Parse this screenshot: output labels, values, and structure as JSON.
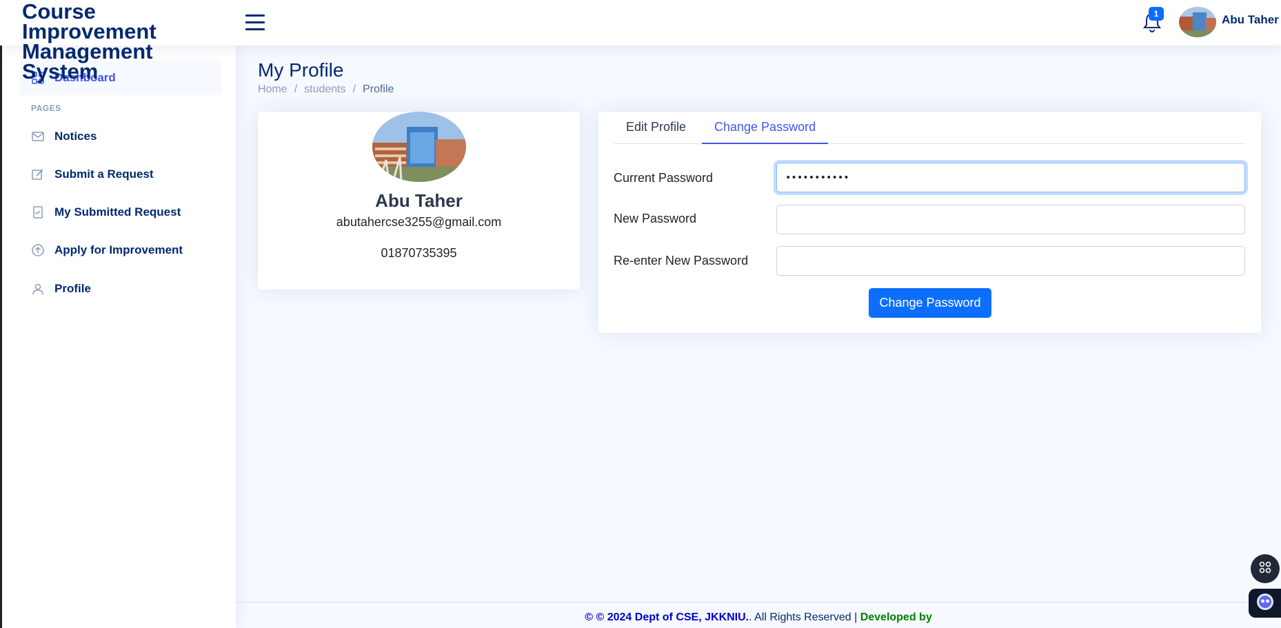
{
  "header": {
    "logo_text": "Course Improvement Management System",
    "notification_count": "1",
    "user_name": "Abu Taher"
  },
  "sidebar": {
    "heading": "PAGES",
    "items": [
      {
        "label": "Dashboard",
        "icon": "grid-icon"
      },
      {
        "label": "Notices",
        "icon": "envelope-icon"
      },
      {
        "label": "Submit a Request",
        "icon": "pencil-square-icon"
      },
      {
        "label": "My Submitted Request",
        "icon": "journal-check-icon"
      },
      {
        "label": "Apply for Improvement",
        "icon": "arrow-up-circle-icon"
      },
      {
        "label": "Profile",
        "icon": "person-icon"
      }
    ]
  },
  "main": {
    "title": "My Profile",
    "breadcrumb": [
      "Home",
      "students",
      "Profile"
    ]
  },
  "profile": {
    "name": "Abu Taher",
    "email": "abutahercse3255@gmail.com",
    "phone": "01870735395"
  },
  "tabs": [
    {
      "label": "Edit Profile",
      "active": false
    },
    {
      "label": "Change Password",
      "active": true
    }
  ],
  "form": {
    "current_password_label": "Current Password",
    "current_password_value": "•••••••••••",
    "new_password_label": "New Password",
    "new_password_value": "",
    "reenter_password_label": "Re-enter New Password",
    "reenter_password_value": "",
    "submit_label": "Change Password"
  },
  "footer": {
    "copyright": "© © 2024 Dept of CSE, JKKNIU.",
    "rights": ". All Rights Reserved | ",
    "developed": "Developed by"
  },
  "colors": {
    "primary": "#0d6efd",
    "accent": "#4154f1",
    "navy": "#012970",
    "background": "#f6f9ff"
  }
}
